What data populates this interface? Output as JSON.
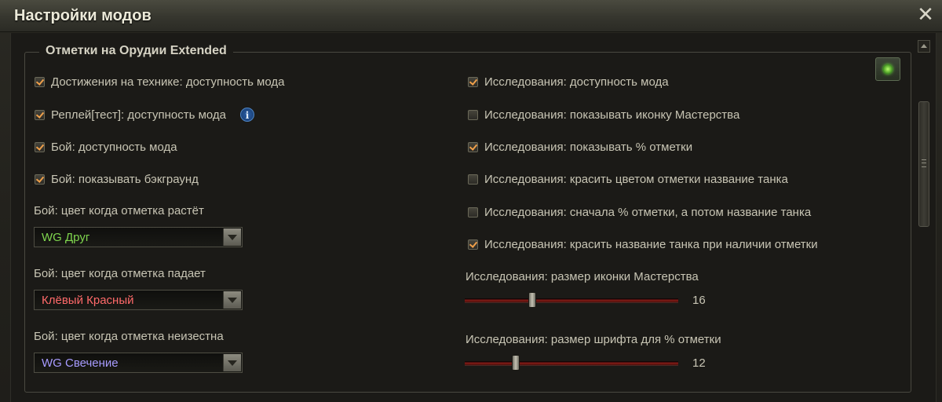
{
  "window": {
    "title": "Настройки модов"
  },
  "group": {
    "title": "Отметки на Орудии Extended",
    "left_checkboxes": [
      {
        "label": "Достижения на технике: доступность мода",
        "checked": true
      },
      {
        "label": "Реплей[тест]: доступность мода",
        "checked": true,
        "info": "i"
      },
      {
        "label": "Бой: доступность мода",
        "checked": true
      },
      {
        "label": "Бой: показывать бэкграунд",
        "checked": true
      }
    ],
    "dropdowns": [
      {
        "label": "Бой: цвет когда отметка растёт",
        "value": "WG Друг",
        "color": "#7fd64e"
      },
      {
        "label": "Бой: цвет когда отметка падает",
        "value": "Клёвый Красный",
        "color": "#ff6a6a"
      },
      {
        "label": "Бой: цвет когда отметка неизестна",
        "value": "WG Свечение",
        "color": "#a79bff"
      }
    ],
    "right_checkboxes": [
      {
        "label": "Исследования: доступность мода",
        "checked": true
      },
      {
        "label": "Исследования: показывать иконку Мастерства",
        "checked": false
      },
      {
        "label": "Исследования: показывать % отметки",
        "checked": true
      },
      {
        "label": "Исследования: красить цветом отметки название танка",
        "checked": false
      },
      {
        "label": "Исследования: сначала % отметки, а потом название танка",
        "checked": false
      },
      {
        "label": "Исследования: красить название танка при наличии отметки",
        "checked": true
      }
    ],
    "sliders": [
      {
        "label": "Исследования: размер иконки Мастерства",
        "value": "16",
        "fraction": 0.31
      },
      {
        "label": "Исследования: размер шрифта для % отметки",
        "value": "12",
        "fraction": 0.23
      }
    ]
  },
  "colors": {
    "checkmark": "#f0a04a",
    "slider_track": "#8a1b16",
    "accent_green": "#6cff34"
  }
}
